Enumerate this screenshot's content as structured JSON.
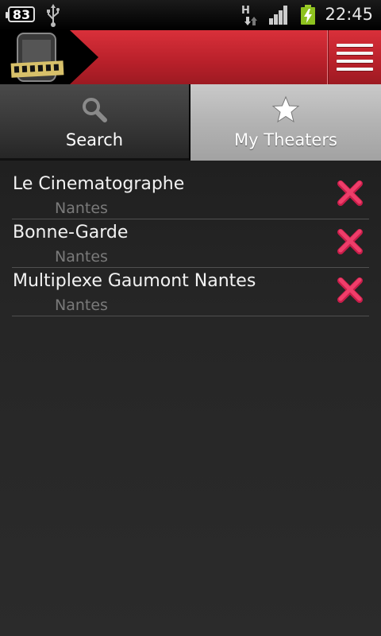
{
  "status_bar": {
    "battery_level_left": "83",
    "network_type": "H",
    "time": "22:45"
  },
  "header": {
    "logo_icon": "cinema-phone-logo",
    "menu_icon": "hamburger-menu-icon"
  },
  "tabs": [
    {
      "label": "Search",
      "icon": "search-icon",
      "selected": false
    },
    {
      "label": "My Theaters",
      "icon": "star-icon",
      "selected": true
    }
  ],
  "theaters": [
    {
      "name": "Le Cinematographe",
      "city": "Nantes"
    },
    {
      "name": "Bonne-Garde",
      "city": "Nantes"
    },
    {
      "name": "Multiplexe Gaumont Nantes",
      "city": "Nantes"
    }
  ],
  "colors": {
    "header_red": "#c02530",
    "remove_pink": "#e8335f"
  }
}
